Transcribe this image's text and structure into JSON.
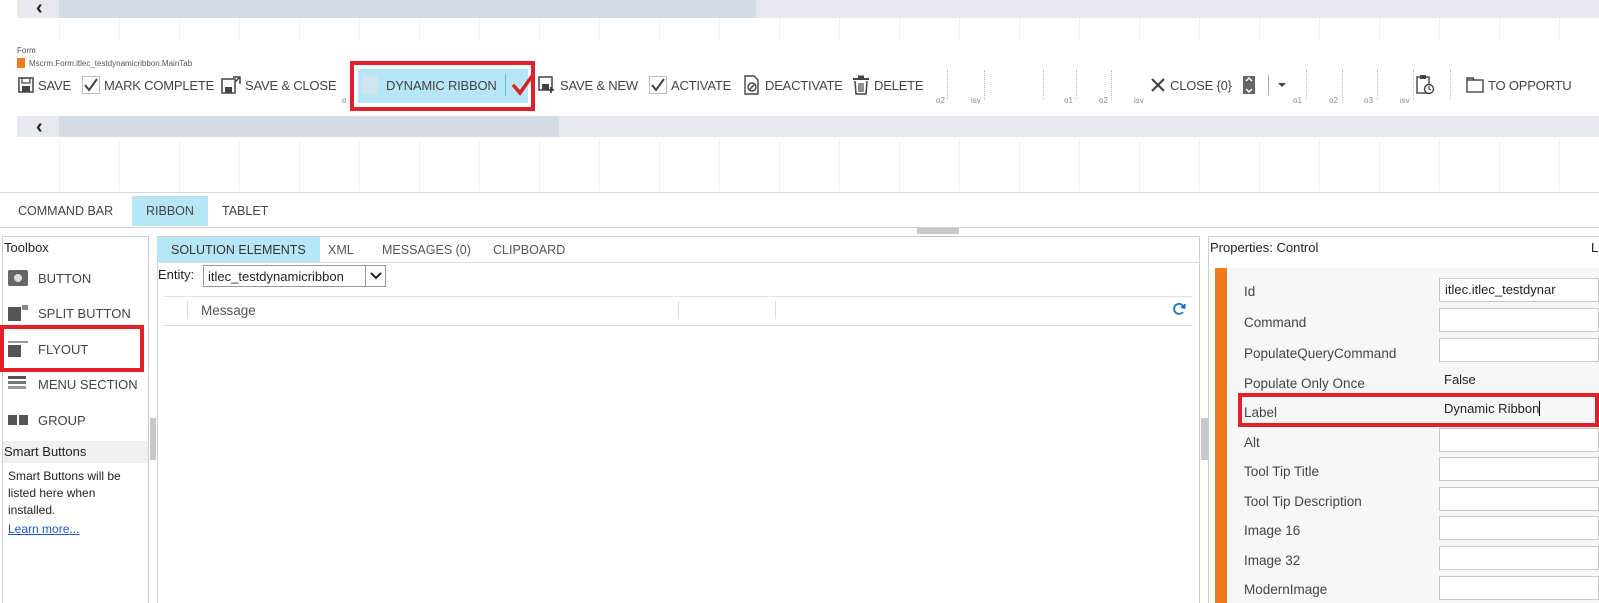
{
  "ribbon": {
    "form_label": "Form",
    "tab_name": "Mscrm.Form.itlec_testdynamicribbon.MainTab",
    "buttons": {
      "save": "SAVE",
      "mark_complete": "MARK COMPLETE",
      "save_close": "SAVE & CLOSE",
      "dynamic_ribbon": "DYNAMIC RIBBON",
      "save_new": "SAVE & NEW",
      "activate": "ACTIVATE",
      "deactivate": "DEACTIVATE",
      "delete": "DELETE",
      "close": "CLOSE {0}",
      "to_opportunity": "TO OPPORTU"
    },
    "markers": {
      "o1_a": "o1",
      "o2_a": "o2",
      "isv_a": "isv",
      "o1_b": "o1",
      "o2_b": "o2",
      "isv_b": "isv",
      "o1_c": "o1",
      "o2_c": "o2",
      "o3_c": "o3",
      "isv_c": "isv"
    }
  },
  "view_tabs": [
    "COMMAND BAR",
    "RIBBON",
    "TABLET"
  ],
  "toolbox": {
    "title": "Toolbox",
    "items": [
      "BUTTON",
      "SPLIT BUTTON",
      "FLYOUT",
      "MENU SECTION",
      "GROUP"
    ],
    "smart_buttons_title": "Smart Buttons",
    "smart_buttons_text": "Smart Buttons will be listed here when installed.",
    "learn_more": "Learn more..."
  },
  "center": {
    "tabs": [
      "SOLUTION ELEMENTS",
      "XML",
      "MESSAGES (0)",
      "CLIPBOARD"
    ],
    "entity_label": "Entity:",
    "entity_value": "itlec_testdynamicribbon",
    "message_header": "Message"
  },
  "properties": {
    "title": "Properties: Control",
    "title_right": "L",
    "fields": [
      {
        "label": "Id",
        "value": "itlec.itlec_testdynar"
      },
      {
        "label": "Command",
        "value": ""
      },
      {
        "label": "PopulateQueryCommand",
        "value": ""
      },
      {
        "label": "Populate Only Once",
        "value": "False"
      },
      {
        "label": "Label",
        "value": "Dynamic Ribbon"
      },
      {
        "label": "Alt",
        "value": ""
      },
      {
        "label": "Tool Tip Title",
        "value": ""
      },
      {
        "label": "Tool Tip Description",
        "value": ""
      },
      {
        "label": "Image 16",
        "value": ""
      },
      {
        "label": "Image 32",
        "value": ""
      },
      {
        "label": "ModernImage",
        "value": ""
      }
    ]
  },
  "colors": {
    "accent_blue": "#b7e6f6",
    "highlight_red": "#e0202b",
    "orange_bar": "#f07a1f",
    "check_red": "#d9202b"
  }
}
